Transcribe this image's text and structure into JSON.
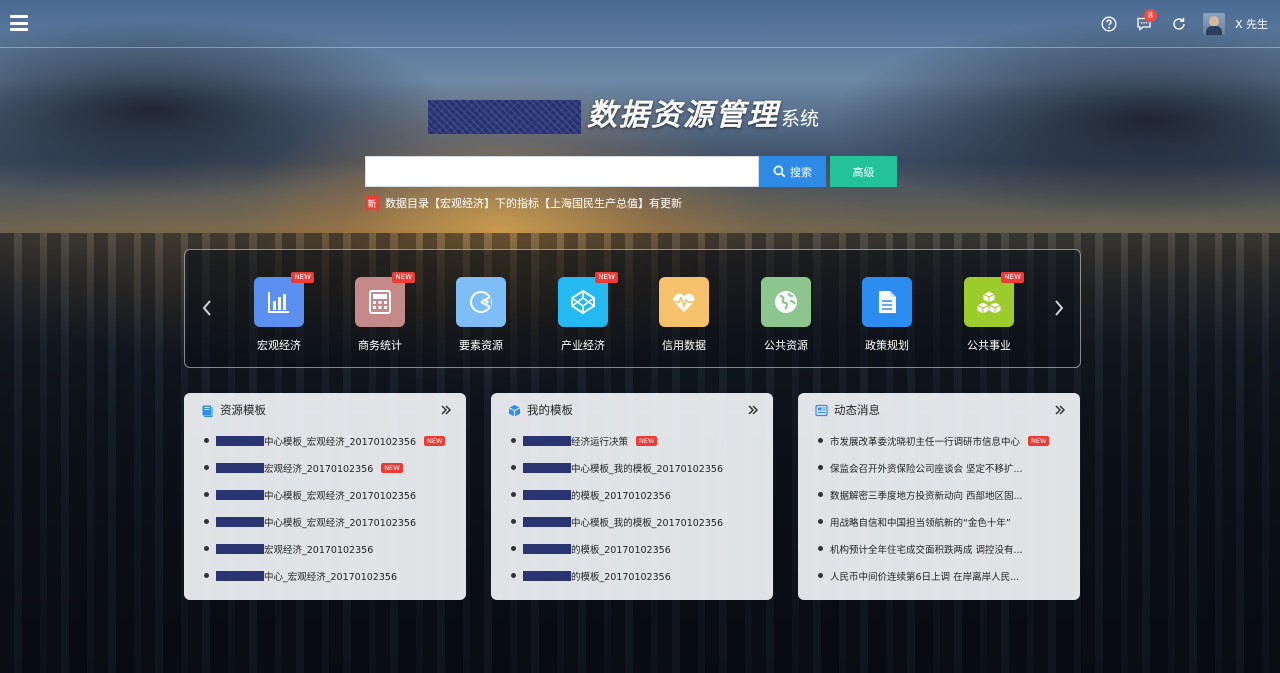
{
  "header": {
    "menu_icon": "hamburger-menu-icon",
    "help_icon": "question-circle-icon",
    "message_icon": "message-icon",
    "message_badge": "8",
    "refresh_icon": "refresh-icon",
    "username": "X 先生"
  },
  "title": {
    "main": "数据资源管理",
    "sub": "系统"
  },
  "search": {
    "value": "",
    "placeholder": "",
    "button_label": "搜索",
    "advanced_label": "高级"
  },
  "notice": {
    "tag": "新",
    "text": "数据目录【宏观经济】下的指标【上海国民生产总值】有更新"
  },
  "categories": {
    "new_label": "NEW",
    "items": [
      {
        "label": "宏观经济",
        "icon": "bar-chart-icon",
        "color": "#5b8ff0",
        "new": true
      },
      {
        "label": "商务统计",
        "icon": "calculator-icon",
        "color": "#c48a8a",
        "new": true
      },
      {
        "label": "要素资源",
        "icon": "pacman-icon",
        "color": "#7fbef5",
        "new": false
      },
      {
        "label": "产业经济",
        "icon": "codepen-icon",
        "color": "#25b9f2",
        "new": true
      },
      {
        "label": "信用数据",
        "icon": "heartbeat-icon",
        "color": "#f5c16b",
        "new": false
      },
      {
        "label": "公共资源",
        "icon": "globe-icon",
        "color": "#8cc58e",
        "new": false
      },
      {
        "label": "政策规划",
        "icon": "document-icon",
        "color": "#2d8cf0",
        "new": false
      },
      {
        "label": "公共事业",
        "icon": "cubes-icon",
        "color": "#9ccc2c",
        "new": true
      }
    ]
  },
  "cards": [
    {
      "title": "资源模板",
      "icon": "book-icon",
      "items": [
        {
          "text": "中心模板_宏观经济_20170102356",
          "new": true
        },
        {
          "text": "宏观经济_20170102356",
          "new": true
        },
        {
          "text": "中心模板_宏观经济_20170102356",
          "new": false
        },
        {
          "text": "中心模板_宏观经济_20170102356",
          "new": false
        },
        {
          "text": "宏观经济_20170102356",
          "new": false
        },
        {
          "text": "中心_宏观经济_20170102356",
          "new": false
        }
      ]
    },
    {
      "title": "我的模板",
      "icon": "cube-icon",
      "items": [
        {
          "text": "经济运行决策",
          "new": true
        },
        {
          "text": "中心模板_我的模板_20170102356",
          "new": false
        },
        {
          "text": "的模板_20170102356",
          "new": false
        },
        {
          "text": "中心模板_我的模板_20170102356",
          "new": false
        },
        {
          "text": "的模板_20170102356",
          "new": false
        },
        {
          "text": "的模板_20170102356",
          "new": false
        }
      ]
    },
    {
      "title": "动态消息",
      "icon": "news-icon",
      "items": [
        {
          "text": "市发展改革委沈晓初主任一行调研市信息中心",
          "new": true
        },
        {
          "text": "保监会召开外资保险公司座谈会 坚定不移扩...",
          "new": false
        },
        {
          "text": "数据解密三季度地方投资新动向 西部地区固...",
          "new": false
        },
        {
          "text": "用战略自信和中国担当领航新的“金色十年”",
          "new": false
        },
        {
          "text": "机构预计全年住宅成交面积跌两成 调控没有...",
          "new": false
        },
        {
          "text": "人民币中间价连续第6日上调 在岸离岸人民...",
          "new": false
        }
      ]
    }
  ],
  "list_new_label": "NEW"
}
